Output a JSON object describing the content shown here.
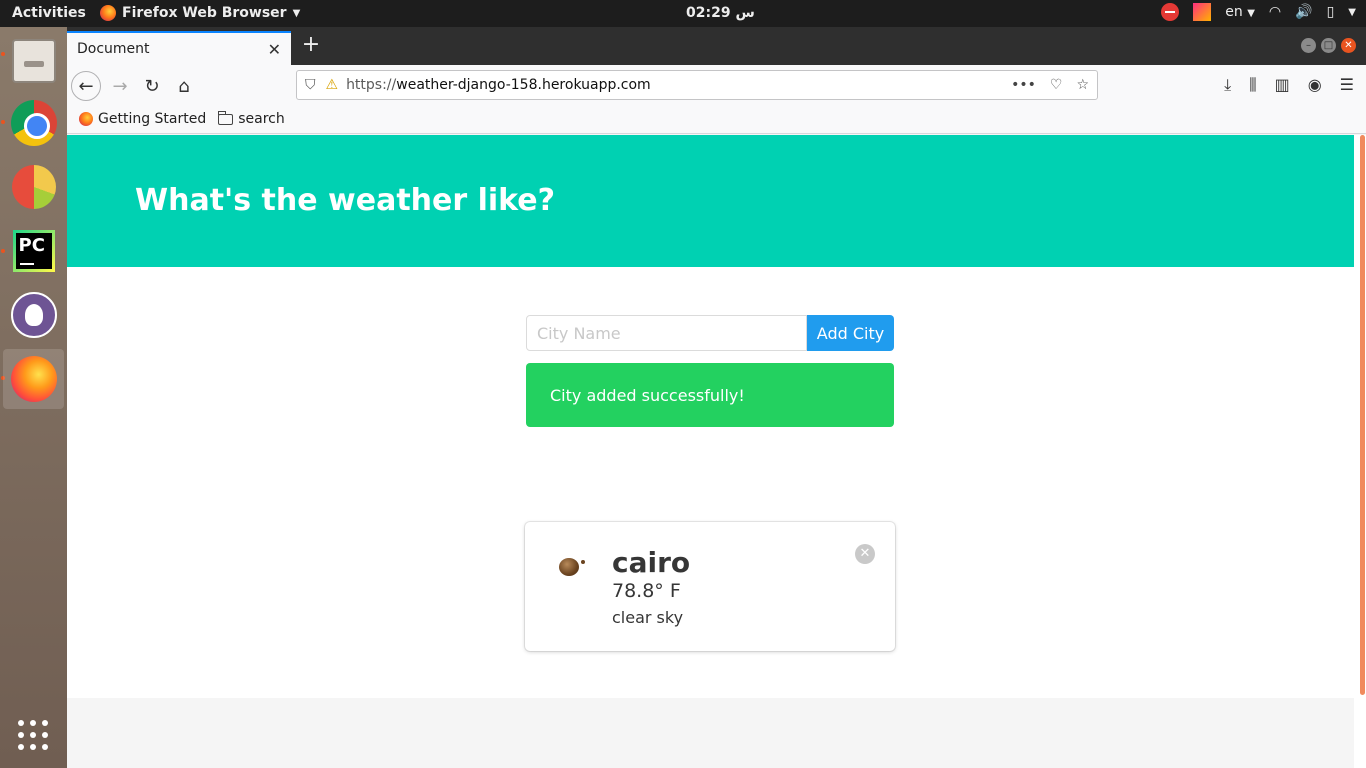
{
  "topbar": {
    "activities": "Activities",
    "app_name": "Firefox Web Browser",
    "clock": "02:29 س",
    "language": "en"
  },
  "dock": {
    "items": [
      "files-icon",
      "chrome-icon",
      "chart-icon",
      "pycharm-icon",
      "github-icon",
      "firefox-icon"
    ],
    "show_apps": "app-grid-icon"
  },
  "browser": {
    "tab_title": "Document",
    "url_prefix": "https://",
    "url_domain": "weather-django-158.herokuapp.com",
    "bookmarks": [
      "Getting Started",
      "search"
    ]
  },
  "page": {
    "heading": "What's the weather like?",
    "city_input_placeholder": "City Name",
    "add_button": "Add City",
    "notification": "City added successfully!",
    "weather_card": {
      "city": "cairo",
      "temperature": "78.8° F",
      "description": "clear sky"
    }
  },
  "colors": {
    "hero": "#00d1b2",
    "button": "#209cee",
    "success": "#23d160",
    "accent": "#e95420"
  }
}
